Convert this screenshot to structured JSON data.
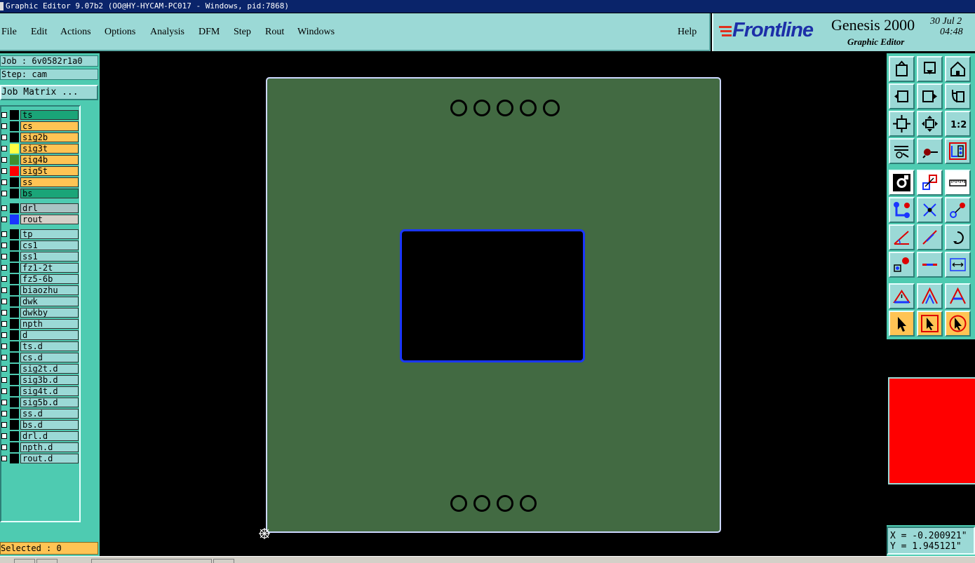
{
  "window": {
    "title": "Graphic Editor 9.07b2 (OO@HY-HYCAM-PC017 - Windows, pid:7868)"
  },
  "menu": {
    "items": [
      "File",
      "Edit",
      "Actions",
      "Options",
      "Analysis",
      "DFM",
      "Step",
      "Rout",
      "Windows"
    ],
    "help": "Help"
  },
  "brand": {
    "logo": "Frontline",
    "product": "Genesis 2000",
    "subtitle": "Graphic Editor",
    "date": "30 Jul 2",
    "time": "04:48"
  },
  "job": {
    "job_label": "Job : 6v0582r1a0",
    "step_label": "Step: cam",
    "matrix_button": "Job Matrix ..."
  },
  "layers": [
    {
      "name": "ts",
      "bg": "#1aa578",
      "swatch": "#000000"
    },
    {
      "name": "cs",
      "bg": "#ffc454",
      "swatch": "#000000"
    },
    {
      "name": "sig2b",
      "bg": "#ffc454",
      "swatch": "#000000"
    },
    {
      "name": "sig3t",
      "bg": "#ffc454",
      "swatch": "#ffff44"
    },
    {
      "name": "sig4b",
      "bg": "#ffc454",
      "swatch": "#3f8f2f"
    },
    {
      "name": "sig5t",
      "bg": "#ffc454",
      "swatch": "#ff0000"
    },
    {
      "name": "ss",
      "bg": "#ffc454",
      "swatch": "#000000"
    },
    {
      "name": "bs",
      "bg": "#1aa578",
      "swatch": "#000000"
    },
    {
      "name": "drl",
      "bg": "#a9c4c4",
      "swatch": "#000000"
    },
    {
      "name": "rout",
      "bg": "#d4d0c8",
      "swatch": "#1a36ff"
    },
    {
      "name": "tp",
      "bg": "#9bd9d6",
      "swatch": "#000000"
    },
    {
      "name": "cs1",
      "bg": "#9bd9d6",
      "swatch": "#000000"
    },
    {
      "name": "ss1",
      "bg": "#9bd9d6",
      "swatch": "#000000"
    },
    {
      "name": "fz1-2t",
      "bg": "#9bd9d6",
      "swatch": "#000000"
    },
    {
      "name": "fz5-6b",
      "bg": "#9bd9d6",
      "swatch": "#000000"
    },
    {
      "name": "biaozhu",
      "bg": "#9bd9d6",
      "swatch": "#000000"
    },
    {
      "name": "dwk",
      "bg": "#9bd9d6",
      "swatch": "#000000"
    },
    {
      "name": "dwkby",
      "bg": "#9bd9d6",
      "swatch": "#000000"
    },
    {
      "name": "npth",
      "bg": "#9bd9d6",
      "swatch": "#000000"
    },
    {
      "name": "d",
      "bg": "#9bd9d6",
      "swatch": "#000000"
    },
    {
      "name": "ts.d",
      "bg": "#9bd9d6",
      "swatch": "#000000"
    },
    {
      "name": "cs.d",
      "bg": "#9bd9d6",
      "swatch": "#000000"
    },
    {
      "name": "sig2t.d",
      "bg": "#9bd9d6",
      "swatch": "#000000"
    },
    {
      "name": "sig3b.d",
      "bg": "#9bd9d6",
      "swatch": "#000000"
    },
    {
      "name": "sig4t.d",
      "bg": "#9bd9d6",
      "swatch": "#000000"
    },
    {
      "name": "sig5b.d",
      "bg": "#9bd9d6",
      "swatch": "#000000"
    },
    {
      "name": "ss.d",
      "bg": "#9bd9d6",
      "swatch": "#000000"
    },
    {
      "name": "bs.d",
      "bg": "#9bd9d6",
      "swatch": "#000000"
    },
    {
      "name": "drl.d",
      "bg": "#9bd9d6",
      "swatch": "#000000"
    },
    {
      "name": "npth.d",
      "bg": "#9bd9d6",
      "swatch": "#000000"
    },
    {
      "name": "rout.d",
      "bg": "#9bd9d6",
      "swatch": "#000000"
    }
  ],
  "selected": "Selected : 0",
  "coords": {
    "x": "X = -0.200921\"",
    "y": "Y = 1.945121\""
  },
  "board": {
    "color": "#426a42",
    "top_holes": 5,
    "bottom_holes": 4
  },
  "tools": [
    {
      "name": "zoom-home-icon",
      "style": "cyan"
    },
    {
      "name": "zoom-in-icon",
      "style": "cyan"
    },
    {
      "name": "home-icon",
      "style": "cyan"
    },
    {
      "name": "pan-left-icon",
      "style": "cyan"
    },
    {
      "name": "pan-right-icon",
      "style": "cyan"
    },
    {
      "name": "undo-rotate-icon",
      "style": "cyan"
    },
    {
      "name": "fit-screen-icon",
      "style": "cyan"
    },
    {
      "name": "center-icon",
      "style": "cyan"
    },
    {
      "name": "one-to-two-icon",
      "style": "cyan"
    },
    {
      "name": "settings-icon",
      "style": "cyan"
    },
    {
      "name": "probe-icon",
      "style": "cyan"
    },
    {
      "name": "layer-panel-icon",
      "style": "cyan"
    },
    {
      "name": "snap-icon",
      "style": "white"
    },
    {
      "name": "measure-box-icon",
      "style": "white"
    },
    {
      "name": "ruler-icon",
      "style": "white"
    },
    {
      "name": "net-icon",
      "style": "cyan"
    },
    {
      "name": "intersect-icon",
      "style": "cyan"
    },
    {
      "name": "connect-icon",
      "style": "cyan"
    },
    {
      "name": "angle-icon",
      "style": "cyan"
    },
    {
      "name": "line-icon",
      "style": "cyan"
    },
    {
      "name": "arc-icon",
      "style": "cyan"
    },
    {
      "name": "pad-icon",
      "style": "cyan"
    },
    {
      "name": "horizontal-line-icon",
      "style": "cyan"
    },
    {
      "name": "dimension-icon",
      "style": "cyan"
    },
    {
      "name": "triangle-small-icon",
      "style": "cyan"
    },
    {
      "name": "triangle-icon",
      "style": "cyan"
    },
    {
      "name": "triangle-filled-icon",
      "style": "cyan"
    },
    {
      "name": "pointer-icon",
      "style": "orange"
    },
    {
      "name": "pointer-box-icon",
      "style": "orange"
    },
    {
      "name": "pointer-circle-icon",
      "style": "orange"
    }
  ]
}
